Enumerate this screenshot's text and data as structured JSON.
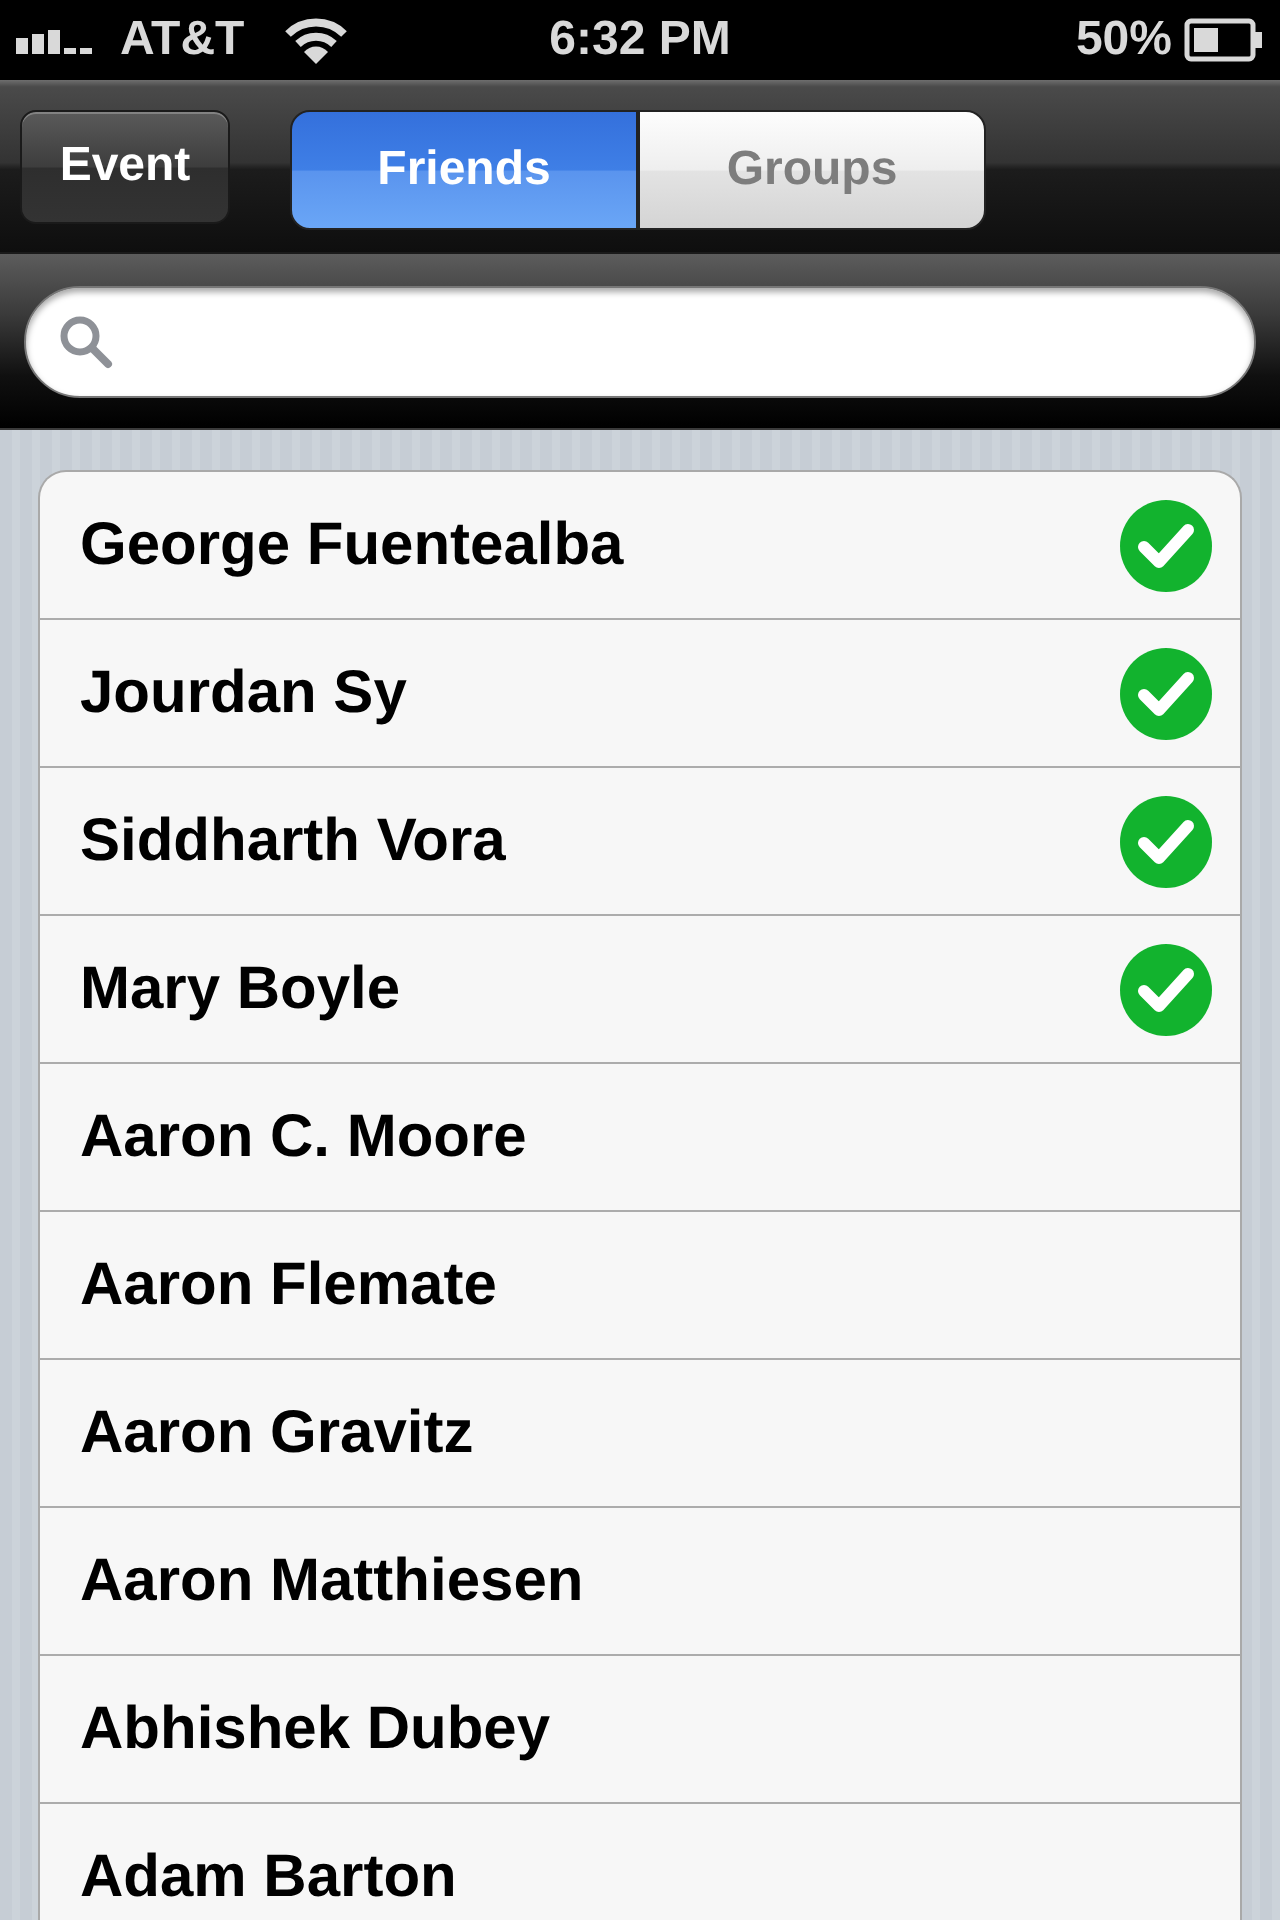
{
  "status_bar": {
    "carrier": "AT&T",
    "time": "6:32 PM",
    "battery": "50%"
  },
  "nav_bar": {
    "left_button": "Event",
    "segments": [
      {
        "label": "Friends",
        "selected": true
      },
      {
        "label": "Groups",
        "selected": false
      }
    ]
  },
  "friends": [
    {
      "name": "George Fuentealba",
      "checked": true
    },
    {
      "name": "Jourdan Sy",
      "checked": true
    },
    {
      "name": "Siddharth Vora",
      "checked": true
    },
    {
      "name": "Mary Boyle",
      "checked": true
    },
    {
      "name": "Aaron C. Moore",
      "checked": false
    },
    {
      "name": "Aaron Flemate",
      "checked": false
    },
    {
      "name": "Aaron Gravitz",
      "checked": false
    },
    {
      "name": "Aaron Matthiesen",
      "checked": false
    },
    {
      "name": "Abhishek Dubey",
      "checked": false
    },
    {
      "name": "Adam Barton",
      "checked": false
    }
  ]
}
